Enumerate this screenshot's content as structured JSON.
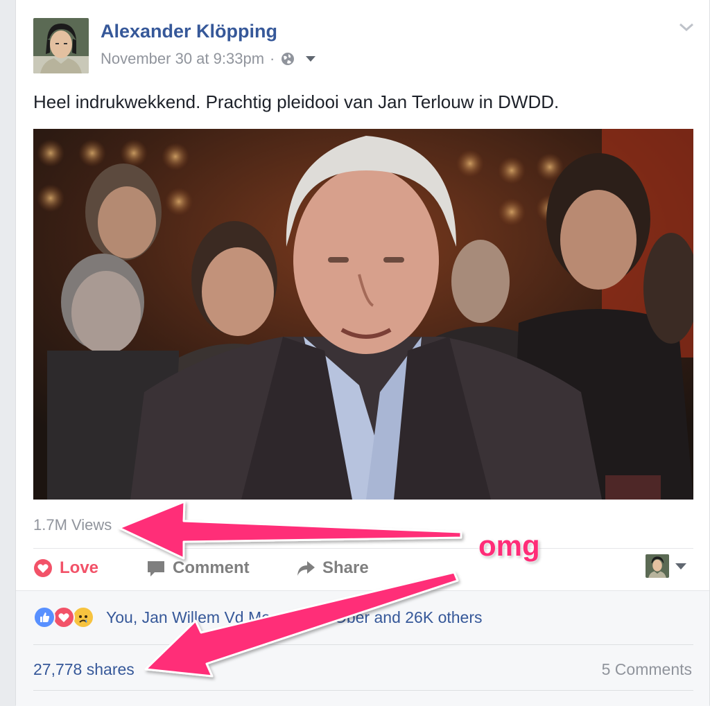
{
  "post": {
    "author": "Alexander Klöpping",
    "timestamp": "November 30 at 9:33pm",
    "separator": "·",
    "privacy_icon": "globe-icon",
    "text": "Heel indrukwekkend. Prachtig pleidooi van Jan Terlouw in DWDD.",
    "views": "1.7M Views"
  },
  "actions": {
    "love_label": "Love",
    "comment_label": "Comment",
    "share_label": "Share"
  },
  "footer": {
    "reaction_icons": [
      "like-icon",
      "love-icon",
      "sad-icon"
    ],
    "reaction_text": "You, Jan Willem Vd Meer, Hans Ober and 26K others",
    "shares": "27,778 shares",
    "comments": "5 Comments"
  },
  "annotation": {
    "label": "omg",
    "color": "#ff2d78"
  },
  "colors": {
    "link_blue": "#365899",
    "love_red": "#f25268",
    "muted_grey": "#90949c"
  }
}
